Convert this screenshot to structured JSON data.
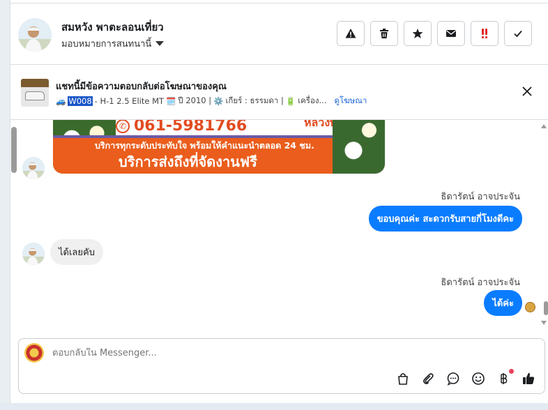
{
  "header": {
    "contact_name": "สมหวัง พาตะลอนเที่ยว",
    "assign_label": "มอบหมายการสนทนานี้",
    "actions": [
      {
        "name": "report-button",
        "icon": "warning-icon"
      },
      {
        "name": "delete-button",
        "icon": "trash-icon"
      },
      {
        "name": "star-button",
        "icon": "star-icon"
      },
      {
        "name": "mail-button",
        "icon": "envelope-icon"
      },
      {
        "name": "spam-button",
        "icon": "double-exclamation-icon"
      },
      {
        "name": "done-button",
        "icon": "check-icon"
      }
    ]
  },
  "ad": {
    "title": "แชทนี้มีข้อความตอบกลับต่อโฆษณาของคุณ",
    "car_emoji": "🚙",
    "code": "W008",
    "model": " - H-1 2.5 Elite MT ",
    "calendar_emoji": "🗓️",
    "year": " ปี 2010 | ",
    "gear_emoji": "⚙️",
    "gear": " เกียร์ : ธรรมดา | ",
    "battery_emoji": "🔋",
    "engine": " เครื่อง...",
    "view_ad_link": "ดูโฆษณา"
  },
  "banner": {
    "phone": "061-5981766",
    "corner_text": "หลวงพ่อ",
    "line1": "บริการทุกระดับประทับใจ พร้อมให้คำแนะนำตลอด 24 ชม.",
    "line2": "บริการส่งถึงที่จัดงานฟรี"
  },
  "messages": [
    {
      "type": "out",
      "sender": "ธิดารัตน์ อาจประจัน",
      "text": "ขอบคุณค่ะ สะดวกรับสายกี่โมงดีคะ"
    },
    {
      "type": "in",
      "text": "ได้เลยคับ"
    },
    {
      "type": "out",
      "sender": "ธิดารัตน์ อาจประจัน",
      "text": "ได้ค่ะ"
    }
  ],
  "composer": {
    "placeholder": "ตอบกลับใน Messenger...",
    "tools": [
      "bag-icon",
      "paperclip-icon",
      "chat-bubble-icon",
      "smiley-icon",
      "baht-icon",
      "thumbs-up-icon"
    ]
  },
  "colors": {
    "accent": "#0a7cff",
    "link": "#1a66d6",
    "highlight": "#1a56c6"
  }
}
